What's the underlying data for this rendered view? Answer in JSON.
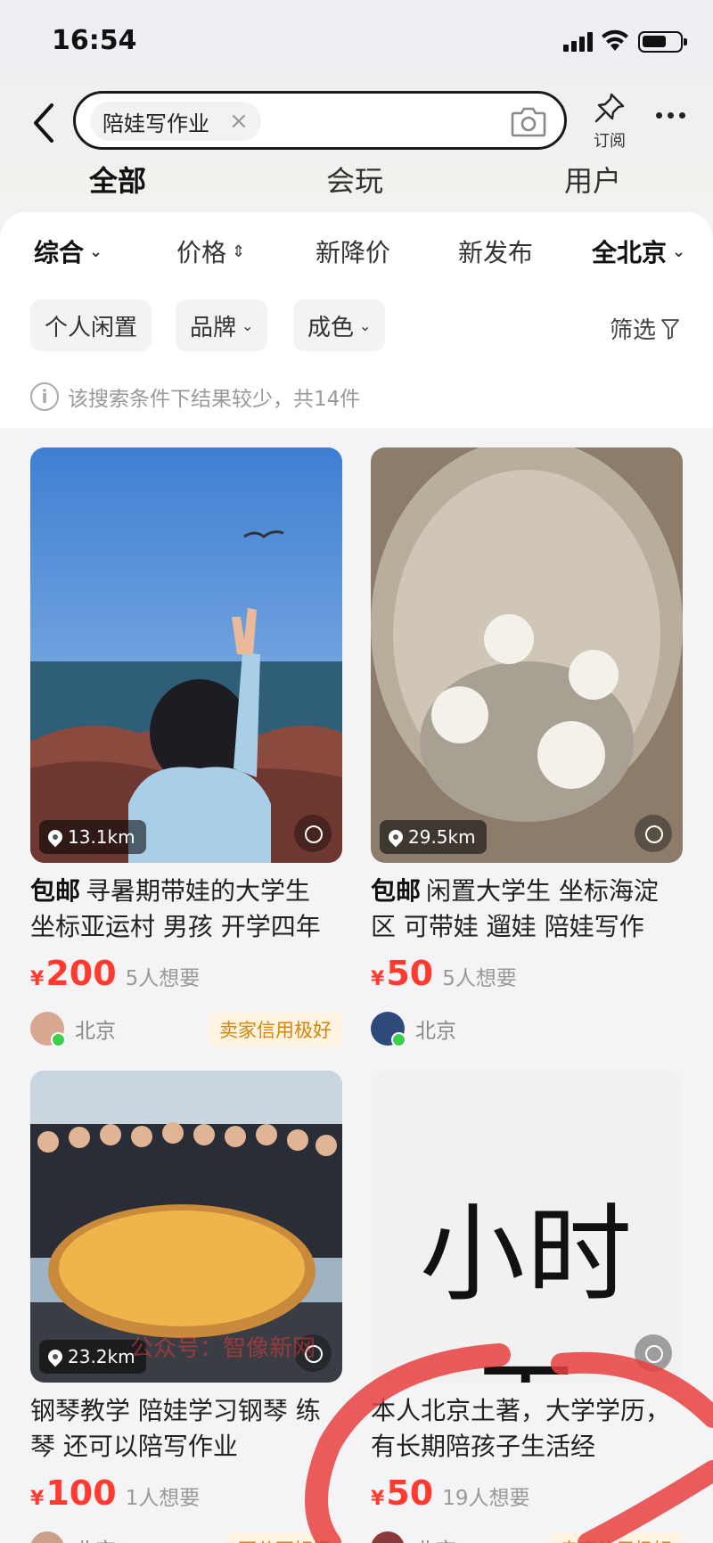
{
  "status_bar": {
    "time": "16:54"
  },
  "header": {
    "search_chip": "陪娃写作业",
    "clear_glyph": "×",
    "subscribe_label": "订阅"
  },
  "top_tabs": [
    {
      "label": "全部",
      "active": true
    },
    {
      "label": "会玩",
      "active": false
    },
    {
      "label": "用户",
      "active": false
    }
  ],
  "sort_bar": [
    {
      "label": "综合",
      "caret": "⌄"
    },
    {
      "label": "价格",
      "caret": "⇕"
    },
    {
      "label": "新降价"
    },
    {
      "label": "新发布"
    },
    {
      "label": "全北京",
      "caret": "⌄"
    }
  ],
  "filters": [
    {
      "label": "个人闲置"
    },
    {
      "label": "品牌",
      "caret": "⌄"
    },
    {
      "label": "成色",
      "caret": "⌄"
    }
  ],
  "screen_label": "筛选",
  "notice": "该搜索条件下结果较少，共14件",
  "listings": [
    {
      "distance": "13.1km",
      "free_ship": "包邮",
      "title": "寻暑期带娃的大学生 坐标亚运村 男孩 开学四年",
      "price": "200",
      "want": "5人想要",
      "city": "北京",
      "credit": "卖家信用极好"
    },
    {
      "distance": "29.5km",
      "free_ship": "包邮",
      "title": "闲置大学生 坐标海淀区 可带娃 遛娃 陪娃写作",
      "price": "50",
      "want": "5人想要",
      "city": "北京",
      "credit": ""
    },
    {
      "distance": "23.2km",
      "free_ship": "",
      "title": "钢琴教学 陪娃学习钢琴 练琴 还可以陪写作业",
      "price": "100",
      "want": "1人想要",
      "city": "北京",
      "credit": "百分百好评"
    },
    {
      "image_text": "小时工",
      "distance": "",
      "free_ship": "",
      "title": "本人北京土著，大学学历，有长期陪孩子生活经",
      "price": "50",
      "want": "19人想要",
      "city": "北京",
      "credit": "卖家信用极好"
    }
  ],
  "currency": "¥",
  "watermark": "公众号：智像新网",
  "colors": {
    "accent_yellow": "#ffe33f",
    "price_red": "#ff3b2f",
    "credit_orange": "#d8830a"
  }
}
